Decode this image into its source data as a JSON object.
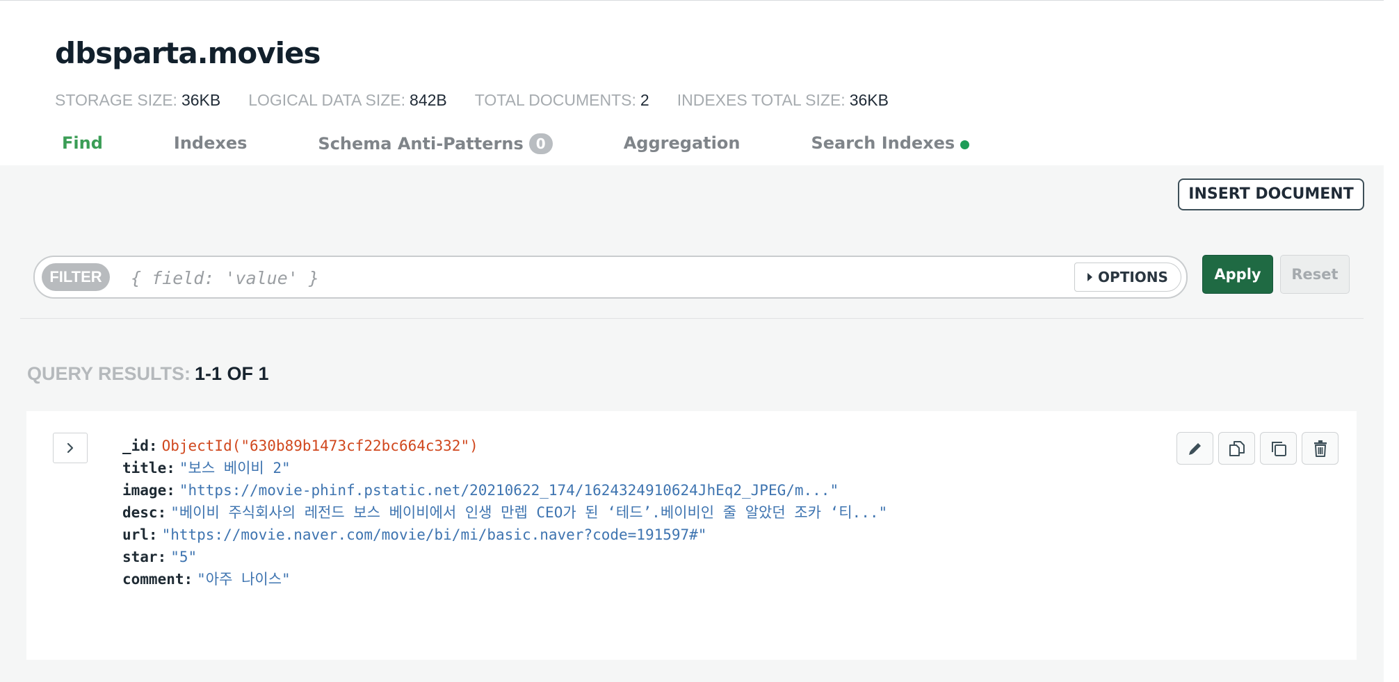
{
  "collection": {
    "title": "dbsparta.movies"
  },
  "stats": [
    {
      "label": "STORAGE SIZE:",
      "value": "36KB"
    },
    {
      "label": "LOGICAL DATA SIZE:",
      "value": "842B"
    },
    {
      "label": "TOTAL DOCUMENTS:",
      "value": "2"
    },
    {
      "label": "INDEXES TOTAL SIZE:",
      "value": "36KB"
    }
  ],
  "tabs": {
    "find": "Find",
    "indexes": "Indexes",
    "schema": "Schema Anti-Patterns",
    "schema_count": "0",
    "aggregation": "Aggregation",
    "search_indexes": "Search Indexes"
  },
  "toolbar": {
    "insert_label": "INSERT DOCUMENT",
    "filter_label": "FILTER",
    "filter_placeholder": "{ field: 'value' }",
    "options_label": "OPTIONS",
    "apply_label": "Apply",
    "reset_label": "Reset"
  },
  "results": {
    "label": "QUERY RESULTS:",
    "range": "1-1 OF 1"
  },
  "document": {
    "fields": [
      {
        "key": "_id:",
        "value": "ObjectId(\"630b89b1473cf22bc664c332\")"
      },
      {
        "key": "title:",
        "value": "\"보스 베이비 2\""
      },
      {
        "key": "image:",
        "value": "\"https://movie-phinf.pstatic.net/20210622_174/1624324910624JhEq2_JPEG/m...\""
      },
      {
        "key": "desc:",
        "value": "\"베이비 주식회사의 레전드 보스 베이비에서 인생 만렙 CEO가 된 ‘테드’.베이비인 줄 알았던 조카 ‘티...\""
      },
      {
        "key": "url:",
        "value": "\"https://movie.naver.com/movie/bi/mi/basic.naver?code=191597#\""
      },
      {
        "key": "star:",
        "value": "\"5\""
      },
      {
        "key": "comment:",
        "value": "\"아주 나이스\""
      }
    ],
    "actions": [
      "edit-icon",
      "copy-icon",
      "clone-icon",
      "trash-icon"
    ]
  },
  "colors": {
    "accent": "#3b9d56",
    "apply": "#1f6a43",
    "object_id": "#d0471d",
    "string": "#3e74b0"
  }
}
